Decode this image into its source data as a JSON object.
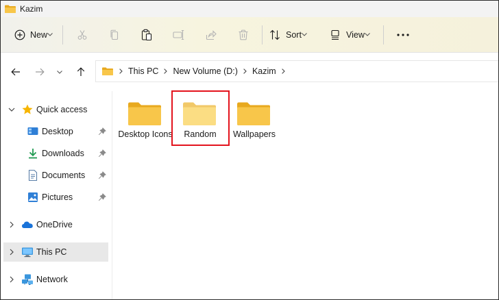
{
  "window": {
    "title": "Kazim"
  },
  "ribbon": {
    "new_label": "New",
    "sort_label": "Sort",
    "view_label": "View",
    "icons": [
      "plus-circle-icon",
      "scissors-icon",
      "copy-icon",
      "paste-icon",
      "rename-icon",
      "share-icon",
      "trash-icon",
      "sort-icon",
      "view-icon",
      "more-icon"
    ]
  },
  "address": {
    "crumbs": [
      "This PC",
      "New Volume (D:)",
      "Kazim"
    ]
  },
  "sidebar": {
    "quick_access": "Quick access",
    "items": [
      {
        "label": "Desktop",
        "icon": "desktop-icon",
        "pinned": true
      },
      {
        "label": "Downloads",
        "icon": "download-icon",
        "pinned": true
      },
      {
        "label": "Documents",
        "icon": "document-icon",
        "pinned": true
      },
      {
        "label": "Pictures",
        "icon": "picture-icon",
        "pinned": true
      }
    ],
    "onedrive": "OneDrive",
    "thispc": "This PC",
    "network": "Network",
    "selected": "This PC"
  },
  "folders": [
    {
      "name": "Desktop Icons",
      "highlighted": false
    },
    {
      "name": "Random",
      "highlighted": true
    },
    {
      "name": "Wallpapers",
      "highlighted": false
    }
  ],
  "colors": {
    "accent": "#0067c0",
    "folder": "#f8c64a",
    "folder_light": "#fbdd83",
    "highlight": "#e3121c",
    "selected_bg": "#e8e8e8"
  }
}
